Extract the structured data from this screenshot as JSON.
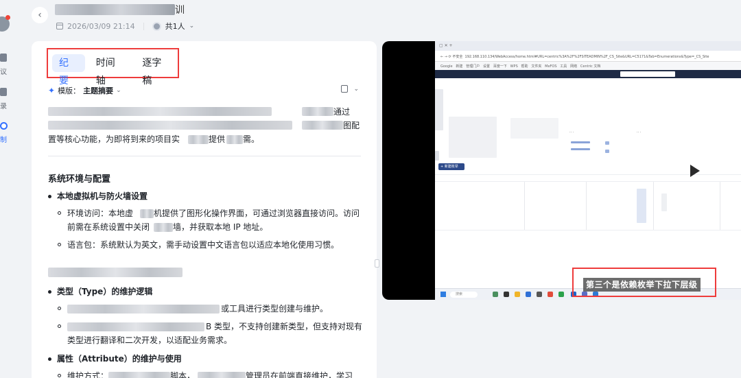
{
  "sidebar": {
    "items": [
      {
        "label": "议",
        "icon": "meeting-icon",
        "active": false
      },
      {
        "label": "录",
        "icon": "record-icon",
        "active": false
      },
      {
        "label": "制",
        "icon": "create-icon",
        "active": true
      }
    ]
  },
  "header": {
    "title_suffix": "训",
    "date": "2026/03/09 21:14",
    "participants": "共1人"
  },
  "tabs": [
    {
      "label": "纪要",
      "active": true
    },
    {
      "label": "时间轴",
      "active": false
    },
    {
      "label": "逐字稿",
      "active": false
    }
  ],
  "template": {
    "prefix": "模版：",
    "value": "主题摘要"
  },
  "summary": {
    "line1_tail": "通过",
    "line2_tail": "图配",
    "line3": "置等核心功能，为即将到来的项目实",
    "line3_mid": "提供",
    "line3_tail": "需。"
  },
  "sections": [
    {
      "heading": "系统环境与配置",
      "subsections": [
        {
          "title": "本地虚拟机与防火墙设置",
          "items": [
            {
              "line1": "环境访问：本地虚",
              "line1_b": "机提供了图形化操作界面，可通过浏览器直接访问。访问",
              "line2": "前需在系统设置中关闭",
              "line2_b": "墙，并获取本地 IP 地址。"
            },
            {
              "line1": "语言包：系统默认为英文，需手动设置中文语言包以适应本地化使用习惯。"
            }
          ]
        }
      ]
    },
    {
      "heading": "",
      "subsections": [
        {
          "title": "类型（Type）的维护逻辑",
          "items": [
            {
              "line1": "或工具进行类型创建与维护。"
            },
            {
              "line1": "B 类型，不支持创建新类型，但支持对现有",
              "line2": "类型进行翻译和二次开发，以适配业务需求。"
            }
          ]
        },
        {
          "title": "属性（Attribute）的维护与使用",
          "items": [
            {
              "line1": "维护方式：",
              "line1_b": "脚本，",
              "line1_c": "管理员在前端直接维护，学习"
            }
          ]
        }
      ]
    }
  ],
  "video": {
    "address": "192.168.110.134/WebAccess/home.html#URL=centric%3A%2F%2FSITEADMIN%2F_CS_Site&URL=C5171&Tab=Enumerations&Type=_CS_Site",
    "bookmarks": [
      "Google",
      "新建",
      "管理门户",
      "设置",
      "百度一下",
      "WPS",
      "帮助",
      "文件夹",
      "MeFOS",
      "工具",
      "网络",
      "Centric 文档"
    ],
    "new_button": "+ 新建枚举值...",
    "caption": "第三个是依赖枚举下拉下层级",
    "taskbar_search": "搜索"
  }
}
